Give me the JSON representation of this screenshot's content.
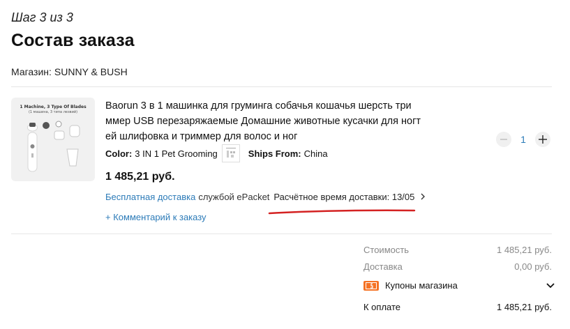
{
  "header": {
    "step": "Шаг 3 из 3",
    "title": "Состав заказа",
    "store_label": "Магазин:",
    "store_name": "SUNNY & BUSH"
  },
  "product": {
    "image_caption_1": "1 Machine, 3 Type Of Blades",
    "image_caption_2": "(1 машина, 3 типа лезвий)",
    "title": "Baorun 3 в 1 машинка для груминга собачья кошачья шерсть три ммер USB перезаряжаемые Домашние животные кусачки для ногт ей шлифовка и триммер для волос и ног",
    "color_label": "Color:",
    "color_value": "3 IN 1 Pet Grooming",
    "ships_label": "Ships From:",
    "ships_value": "China",
    "price": "1 485,21 руб.",
    "quantity": "1",
    "delivery_free": "Бесплатная доставка",
    "delivery_service": "службой ePacket",
    "delivery_estimate": "Расчётное время доставки: 13/05",
    "comment_link": "+ Комментарий к заказу"
  },
  "summary": {
    "cost_label": "Стоимость",
    "cost_value": "1 485,21 руб.",
    "delivery_label": "Доставка",
    "delivery_value": "0,00 руб.",
    "coupon_label": "Купоны магазина",
    "total_label": "К оплате",
    "total_value": "1 485,21 руб."
  },
  "icons": {
    "minus": "minus-icon",
    "plus": "plus-icon",
    "chevron_right": "chevron-right-icon",
    "chevron_down": "chevron-down-icon",
    "coupon": "coupon-icon"
  },
  "colors": {
    "link_blue": "#2c7bb8",
    "annotation_red": "#d42222",
    "coupon_orange": "#f57224"
  }
}
